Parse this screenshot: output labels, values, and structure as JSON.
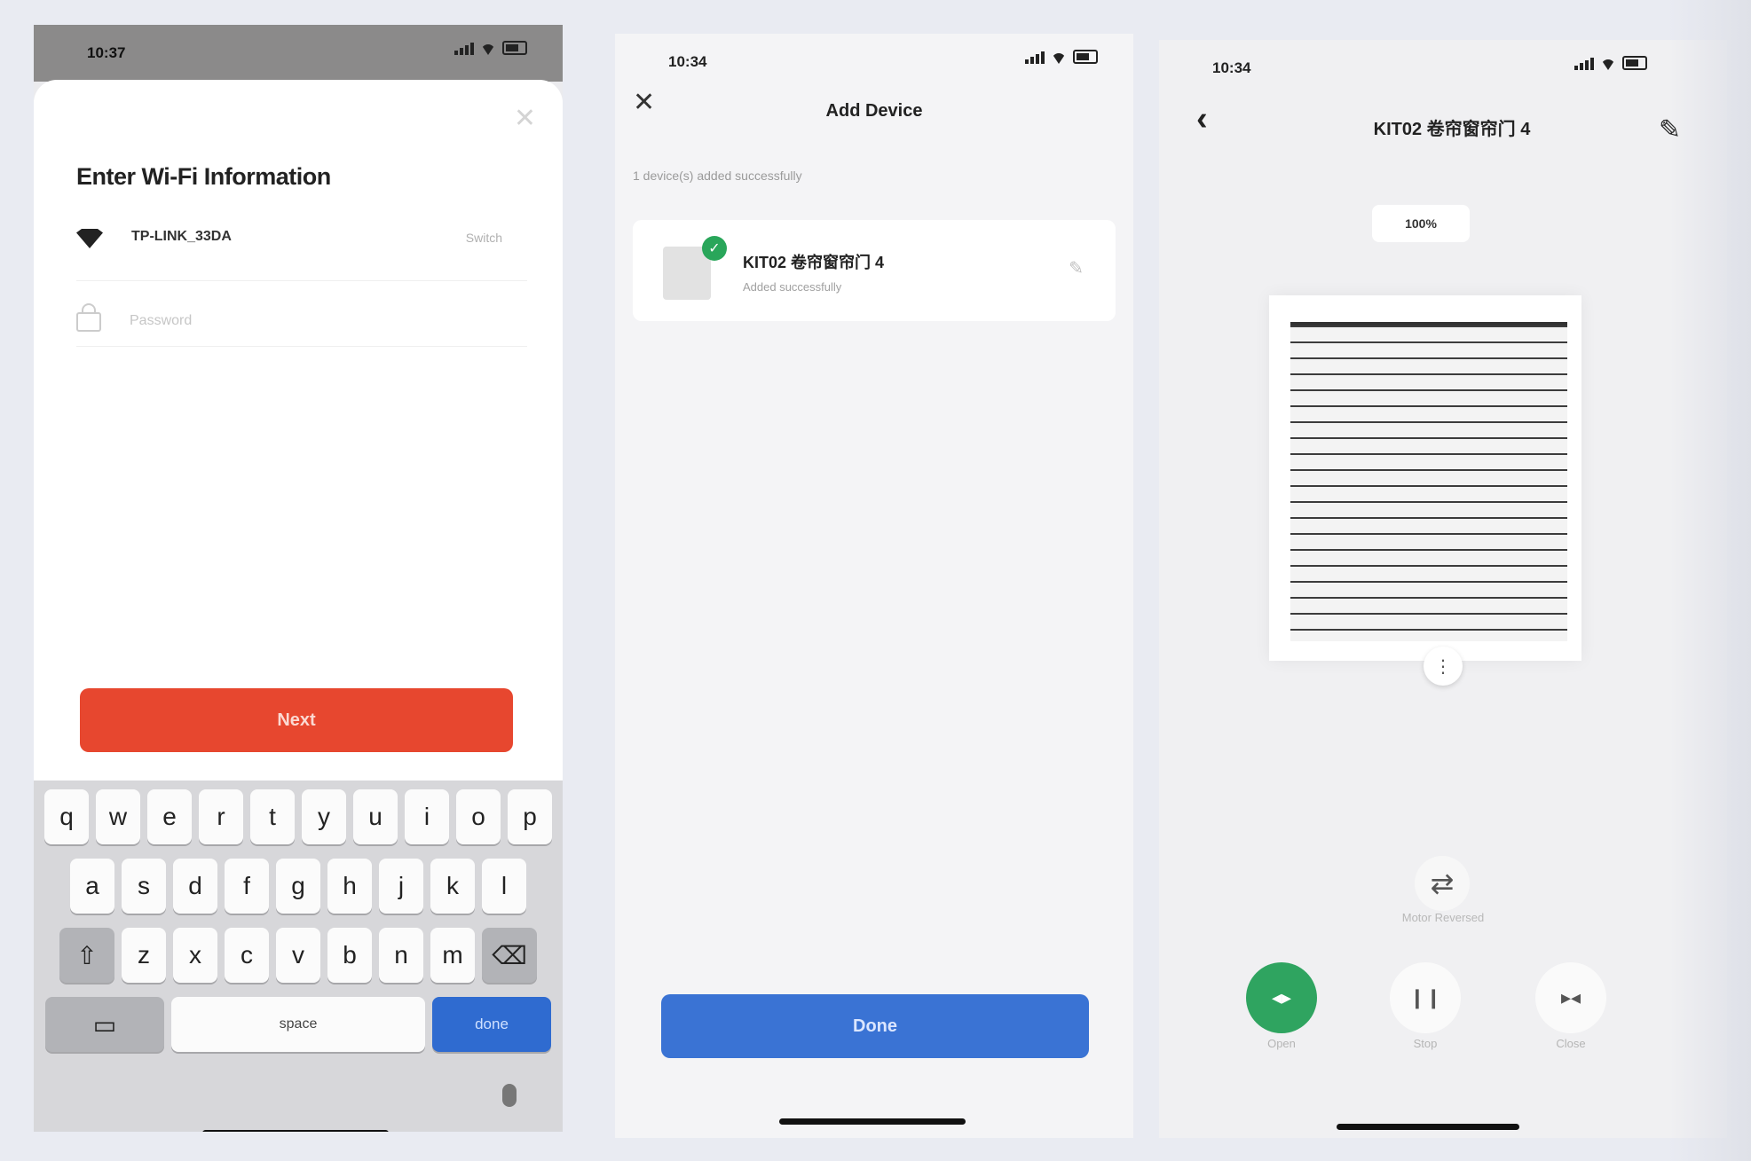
{
  "screen1": {
    "status_time": "10:37",
    "title": "Enter Wi-Fi Information",
    "ssid": "TP-LINK_33DA",
    "switch_label": "Switch",
    "password_placeholder": "Password",
    "next_label": "Next",
    "keyboard": {
      "row1": [
        "q",
        "w",
        "e",
        "r",
        "t",
        "y",
        "u",
        "i",
        "o",
        "p"
      ],
      "row2": [
        "a",
        "s",
        "d",
        "f",
        "g",
        "h",
        "j",
        "k",
        "l"
      ],
      "row3": [
        "z",
        "x",
        "c",
        "v",
        "b",
        "n",
        "m"
      ],
      "space_label": "space",
      "done_label": "done"
    }
  },
  "screen2": {
    "status_time": "10:34",
    "title": "Add Device",
    "hint": "1 device(s) added successfully",
    "device_name": "KIT02 卷帘窗帘门 4",
    "device_status": "Added successfully",
    "done_label": "Done"
  },
  "screen3": {
    "status_time": "10:34",
    "title": "KIT02 卷帘窗帘门 4",
    "percent": "100%",
    "reverse_label": "Motor Reversed",
    "open_label": "Open",
    "stop_label": "Stop",
    "close_label": "Close"
  },
  "colors": {
    "next_button": "#e7472f",
    "done_button": "#3a73d4",
    "keyboard_done": "#2f6bd0",
    "open_button": "#2fa460",
    "success_badge": "#29a65a"
  },
  "icons": [
    "wifi-icon",
    "lock-icon",
    "close-icon",
    "mic-icon",
    "back-icon",
    "edit-icon",
    "check-icon",
    "reverse-icon"
  ]
}
